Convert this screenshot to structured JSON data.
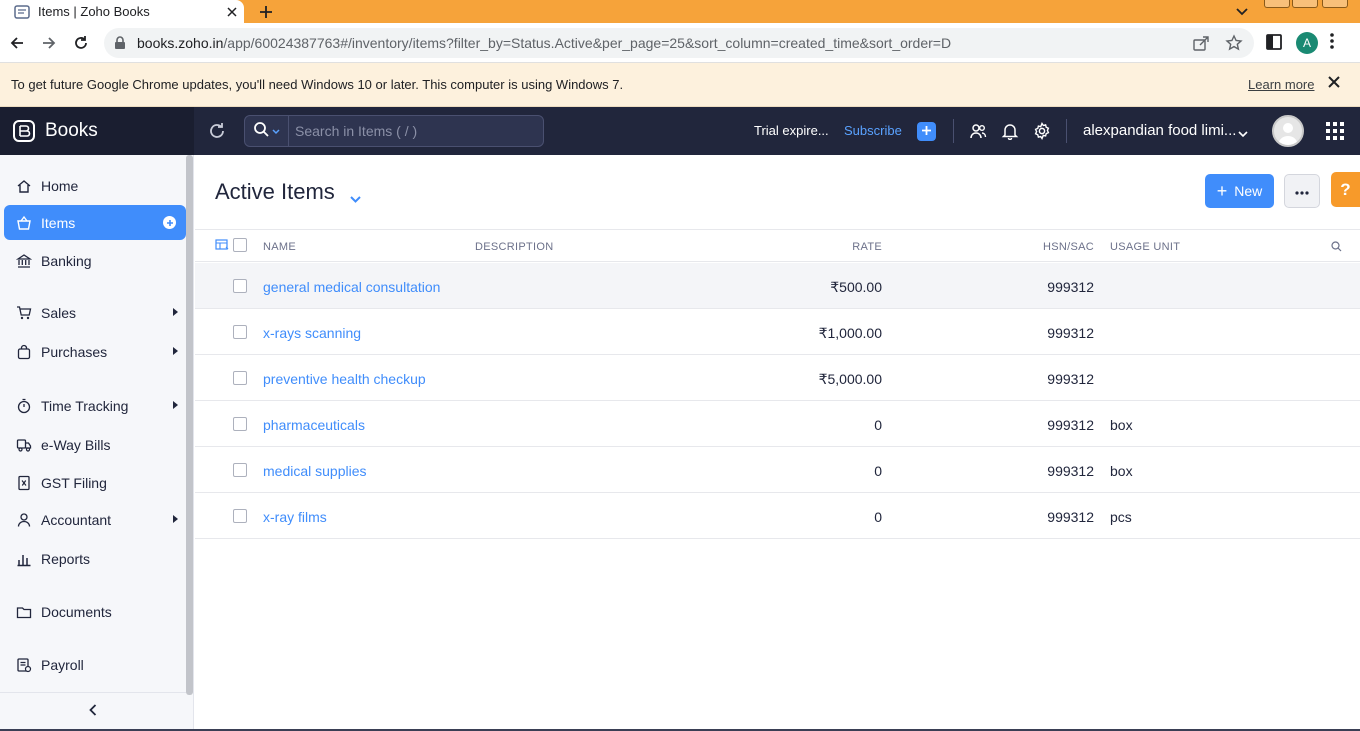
{
  "browser": {
    "tab_title": "Items | Zoho Books",
    "url_host": "books.zoho.in",
    "url_path": "/app/60024387763#/inventory/items?filter_by=Status.Active&per_page=25&sort_column=created_time&sort_order=D",
    "profile_initial": "A",
    "infobar_text": "To get future Google Chrome updates, you'll need Windows 10 or later. This computer is using Windows 7.",
    "infobar_link": "Learn more"
  },
  "header": {
    "brand": "Books",
    "search_placeholder": "Search in Items ( / )",
    "trial_text": "Trial expire...",
    "subscribe_label": "Subscribe",
    "org_name": "alexpandian food limi..."
  },
  "sidebar": {
    "items": [
      {
        "label": "Home",
        "icon": "home-icon"
      },
      {
        "label": "Items",
        "icon": "basket-icon",
        "active": true
      },
      {
        "label": "Banking",
        "icon": "bank-icon"
      },
      {
        "label": "Sales",
        "icon": "cart-icon"
      },
      {
        "label": "Purchases",
        "icon": "bag-icon"
      },
      {
        "label": "Time Tracking",
        "icon": "stopwatch-icon"
      },
      {
        "label": "e-Way Bills",
        "icon": "truck-icon"
      },
      {
        "label": "GST Filing",
        "icon": "document-icon"
      },
      {
        "label": "Accountant",
        "icon": "person-icon"
      },
      {
        "label": "Reports",
        "icon": "bar-chart-icon"
      },
      {
        "label": "Documents",
        "icon": "folder-icon"
      },
      {
        "label": "Payroll",
        "icon": "payroll-icon"
      }
    ]
  },
  "main": {
    "title": "Active Items",
    "new_label": "New",
    "help_label": "?",
    "columns": {
      "name": "NAME",
      "description": "DESCRIPTION",
      "rate": "RATE",
      "hsn": "HSN/SAC",
      "unit": "USAGE UNIT"
    },
    "rows": [
      {
        "name": "general medical consultation",
        "description": "",
        "rate": "₹500.00",
        "hsn": "999312",
        "unit": ""
      },
      {
        "name": "x-rays scanning",
        "description": "",
        "rate": "₹1,000.00",
        "hsn": "999312",
        "unit": ""
      },
      {
        "name": "preventive health checkup",
        "description": "",
        "rate": "₹5,000.00",
        "hsn": "999312",
        "unit": ""
      },
      {
        "name": "pharmaceuticals",
        "description": "",
        "rate": "0",
        "hsn": "999312",
        "unit": "box"
      },
      {
        "name": "medical supplies",
        "description": "",
        "rate": "0",
        "hsn": "999312",
        "unit": "box"
      },
      {
        "name": "x-ray films",
        "description": "",
        "rate": "0",
        "hsn": "999312",
        "unit": "pcs"
      }
    ]
  },
  "colors": {
    "accent": "#408dfb",
    "header_bg": "#21263c",
    "tab_strip": "#f6a33a",
    "help": "#f79a2a"
  }
}
